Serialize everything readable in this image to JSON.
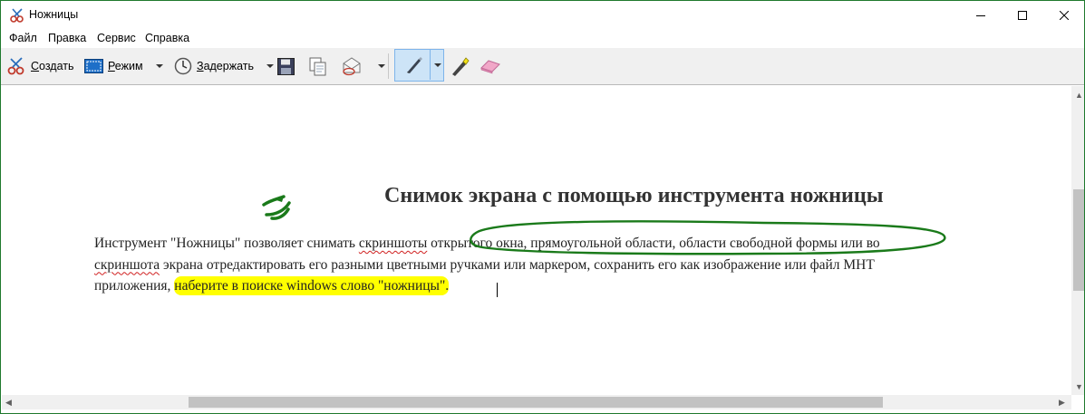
{
  "window": {
    "title": "Ножницы"
  },
  "menu": [
    "Файл",
    "Правка",
    "Сервис",
    "Справка"
  ],
  "toolbar": {
    "new_prefix": "С",
    "new_rest": "оздать",
    "mode_prefix": "Р",
    "mode_rest": "ежим",
    "delay_prefix": "З",
    "delay_rest": "адержать"
  },
  "doc": {
    "heading": "Снимок экрана с помощью инструмента ножницы",
    "line1": {
      "a": "Инструмент \"Ножницы\" позволяет снимать ",
      "b": "скриншоты",
      "c": " открытого окна, прямоугольной области, области свободной формы или во"
    },
    "line2": {
      "a": "скриншота",
      "b": " экрана отредактировать его разными цветными ручками или маркером, сохранить его как изображение или файл MHT"
    },
    "line3": {
      "a": "приложения, ",
      "b": "наберите в поиске windows слово \"ножницы\"."
    }
  },
  "colors": {
    "ink": "#1a7a1a",
    "highlight": "#ffff00",
    "pen_active": "#cde4f7"
  }
}
